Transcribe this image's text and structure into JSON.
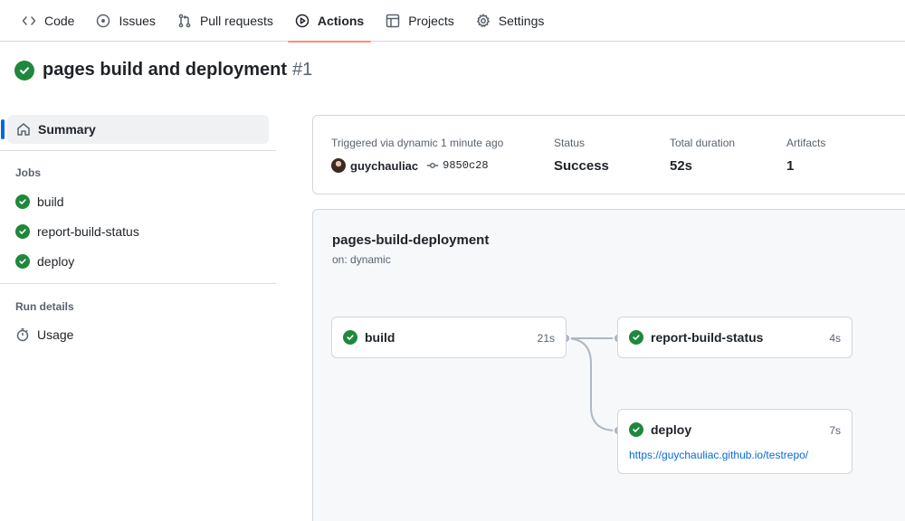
{
  "nav": {
    "tabs": [
      {
        "label": "Code",
        "icon": "code-icon"
      },
      {
        "label": "Issues",
        "icon": "issue-icon"
      },
      {
        "label": "Pull requests",
        "icon": "pull-request-icon"
      },
      {
        "label": "Actions",
        "icon": "play-icon",
        "active": true
      },
      {
        "label": "Projects",
        "icon": "table-icon"
      },
      {
        "label": "Settings",
        "icon": "gear-icon"
      }
    ]
  },
  "run": {
    "title": "pages build and deployment",
    "number": "#1"
  },
  "sidebar": {
    "summary_label": "Summary",
    "jobs_heading": "Jobs",
    "jobs": [
      "build",
      "report-build-status",
      "deploy"
    ],
    "run_details_heading": "Run details",
    "usage_label": "Usage"
  },
  "summary": {
    "trigger_label": "Triggered via dynamic 1 minute ago",
    "user": "guychauliac",
    "commit": "9850c28",
    "status_label": "Status",
    "status_value": "Success",
    "duration_label": "Total duration",
    "duration_value": "52s",
    "artifacts_label": "Artifacts",
    "artifacts_value": "1"
  },
  "workflow": {
    "name": "pages-build-deployment",
    "trigger": "on: dynamic",
    "jobs": {
      "build": {
        "name": "build",
        "duration": "21s"
      },
      "report": {
        "name": "report-build-status",
        "duration": "4s"
      },
      "deploy": {
        "name": "deploy",
        "duration": "7s",
        "url": "https://guychauliac.github.io/testrepo/"
      }
    }
  },
  "colors": {
    "success": "#1f883d",
    "active_tab_underline": "#fd8c73",
    "link": "#0969da"
  }
}
